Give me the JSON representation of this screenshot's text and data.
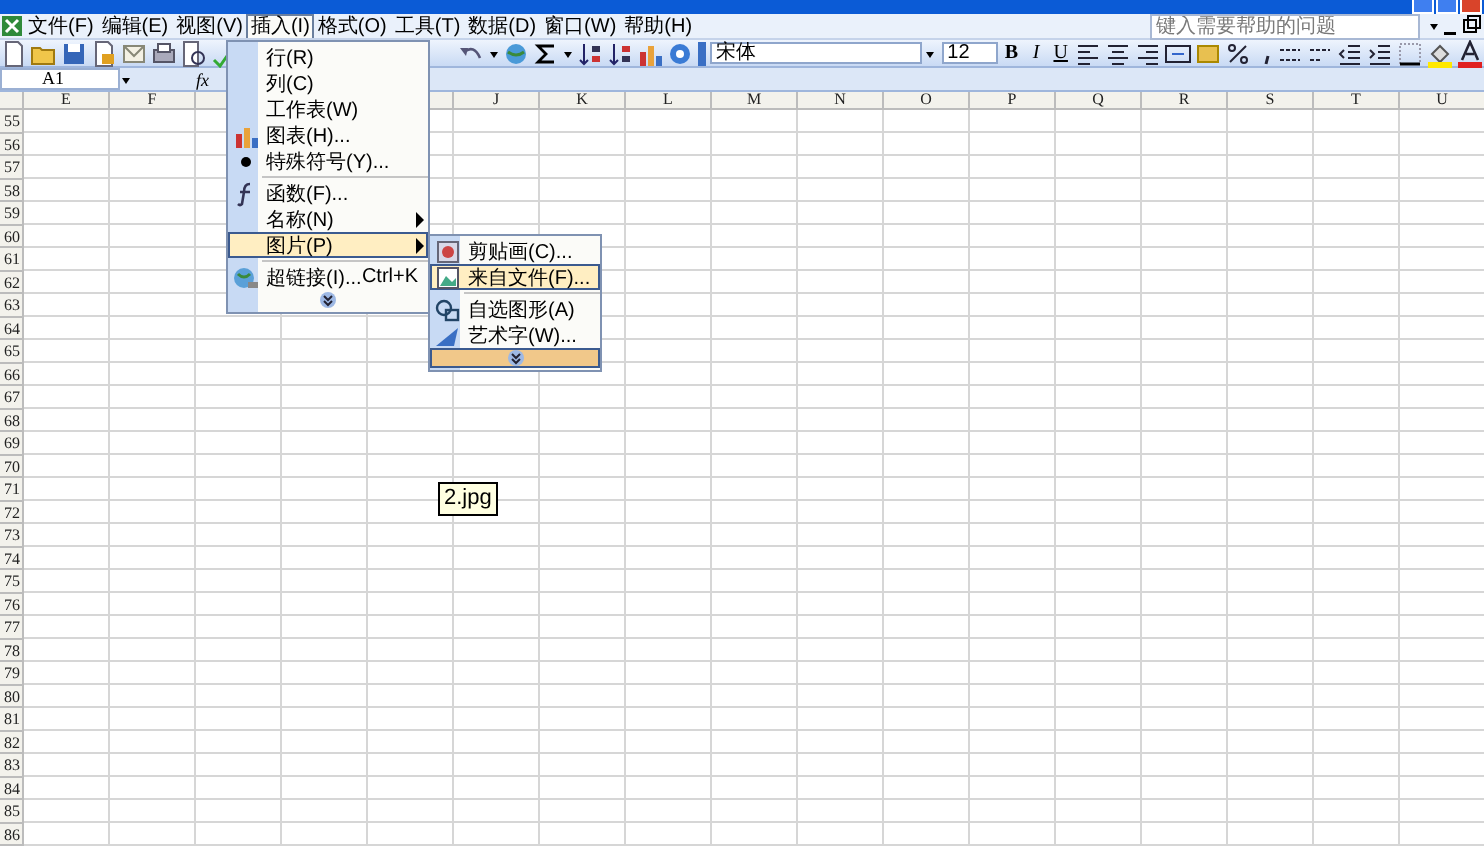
{
  "menu_bar": {
    "items": [
      {
        "label": "文件(F)",
        "selected": false
      },
      {
        "label": "编辑(E)",
        "selected": false
      },
      {
        "label": "视图(V)",
        "selected": false
      },
      {
        "label": "插入(I)",
        "selected": true
      },
      {
        "label": "格式(O)",
        "selected": false
      },
      {
        "label": "工具(T)",
        "selected": false
      },
      {
        "label": "数据(D)",
        "selected": false
      },
      {
        "label": "窗口(W)",
        "selected": false
      },
      {
        "label": "帮助(H)",
        "selected": false
      }
    ],
    "help_search": {
      "placeholder": "键入需要帮助的问题"
    }
  },
  "format_toolbar": {
    "font_name": "宋体",
    "font_size": "12",
    "style_buttons": [
      "B",
      "I",
      "U"
    ]
  },
  "formula_bar": {
    "name_box": "A1",
    "function_label": "fx"
  },
  "sheet": {
    "columns": [
      {
        "label": "E"
      },
      {
        "label": "F"
      },
      {},
      {},
      {},
      {
        "label": "J"
      },
      {
        "label": "K"
      },
      {
        "label": "L"
      },
      {
        "label": "M"
      },
      {
        "label": "N"
      },
      {
        "label": "O"
      },
      {
        "label": "P"
      },
      {
        "label": "Q"
      },
      {
        "label": "R"
      },
      {
        "label": "S"
      },
      {
        "label": "T"
      },
      {
        "label": "U"
      }
    ],
    "rows": [
      "55",
      "56",
      "57",
      "58",
      "59",
      "60",
      "61",
      "62",
      "63",
      "64",
      "65",
      "66",
      "67",
      "68",
      "69",
      "70",
      "71",
      "72",
      "73",
      "74",
      "75",
      "76",
      "77",
      "78",
      "79",
      "80",
      "81",
      "82",
      "83",
      "84",
      "85",
      "86"
    ]
  },
  "insert_menu": {
    "items": [
      {
        "kind": "item",
        "label": "行(R)",
        "selected": false
      },
      {
        "kind": "item",
        "label": "列(C)",
        "selected": false
      },
      {
        "kind": "item",
        "label": "工作表(W)",
        "selected": false
      },
      {
        "kind": "item",
        "label": "图表(H)...",
        "selected": false
      },
      {
        "kind": "item",
        "label": "特殊符号(Y)...",
        "selected": false
      },
      {
        "kind": "separator"
      },
      {
        "kind": "item",
        "label": "函数(F)...",
        "selected": false
      },
      {
        "kind": "submenu",
        "label": "名称(N)",
        "selected": false
      },
      {
        "kind": "submenu",
        "label": "图片(P)",
        "selected": true
      },
      {
        "kind": "separator"
      },
      {
        "kind": "item",
        "label": "超链接(I)...",
        "shortcut": "Ctrl+K",
        "selected": false
      },
      {
        "kind": "expand",
        "selected": false
      }
    ]
  },
  "picture_submenu": {
    "items": [
      {
        "kind": "item",
        "label": "剪贴画(C)...",
        "selected": false
      },
      {
        "kind": "item",
        "label": "来自文件(F)...",
        "selected": true
      },
      {
        "kind": "separator"
      },
      {
        "kind": "item",
        "label": "自选图形(A)",
        "selected": false
      },
      {
        "kind": "item",
        "label": "艺术字(W)...",
        "selected": false
      },
      {
        "kind": "expand",
        "selected": true
      }
    ]
  },
  "tooltip": {
    "text": "2.jpg"
  }
}
